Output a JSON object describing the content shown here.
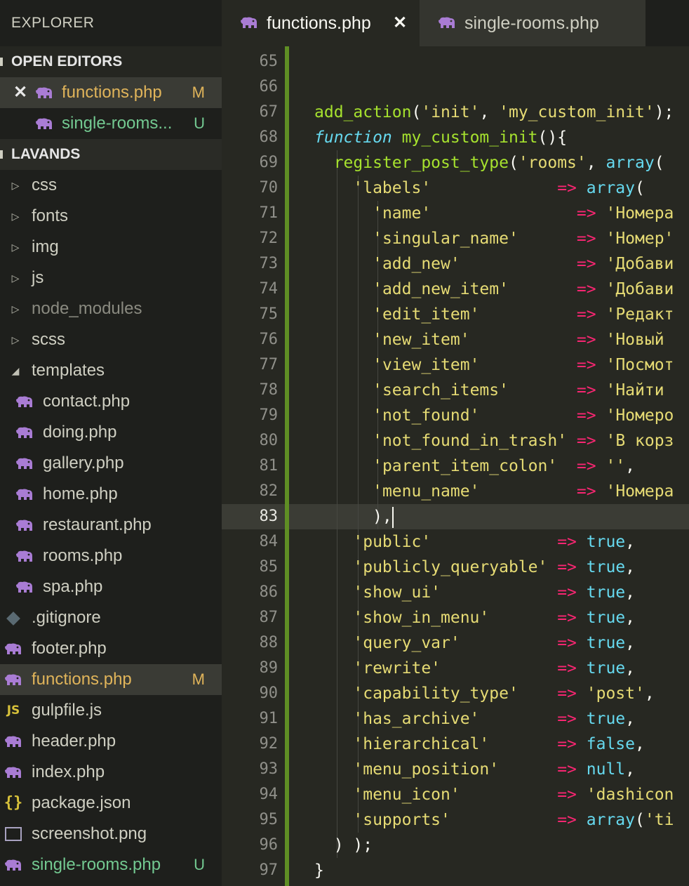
{
  "sidebar": {
    "title": "EXPLORER",
    "open_editors_label": "OPEN EDITORS",
    "open_editors": [
      {
        "label": "functions.php",
        "badge": "M",
        "active": true
      },
      {
        "label": "single-rooms...",
        "badge": "U",
        "active": false
      }
    ],
    "project_label": "LAVANDS",
    "folders": [
      {
        "label": "css"
      },
      {
        "label": "fonts"
      },
      {
        "label": "img"
      },
      {
        "label": "js"
      },
      {
        "label": "node_modules"
      },
      {
        "label": "scss"
      },
      {
        "label": "templates"
      }
    ],
    "template_files": [
      {
        "label": "contact.php"
      },
      {
        "label": "doing.php"
      },
      {
        "label": "gallery.php"
      },
      {
        "label": "home.php"
      },
      {
        "label": "restaurant.php"
      },
      {
        "label": "rooms.php"
      },
      {
        "label": "spa.php"
      }
    ],
    "root_files": [
      {
        "label": ".gitignore",
        "icon": "git-icon",
        "badge": ""
      },
      {
        "label": "footer.php",
        "icon": "php-icon",
        "badge": ""
      },
      {
        "label": "functions.php",
        "icon": "php-icon",
        "badge": "M"
      },
      {
        "label": "gulpfile.js",
        "icon": "js-icon",
        "badge": ""
      },
      {
        "label": "header.php",
        "icon": "php-icon",
        "badge": ""
      },
      {
        "label": "index.php",
        "icon": "php-icon",
        "badge": ""
      },
      {
        "label": "package.json",
        "icon": "json-icon",
        "badge": ""
      },
      {
        "label": "screenshot.png",
        "icon": "image-icon",
        "badge": ""
      },
      {
        "label": "single-rooms.php",
        "icon": "php-icon",
        "badge": "U"
      }
    ],
    "icons": {
      "js": "JS",
      "json": "{}"
    }
  },
  "tabs": [
    {
      "label": "functions.php",
      "active": true,
      "close": "✕"
    },
    {
      "label": "single-rooms.php",
      "active": false
    }
  ],
  "editor": {
    "current_line": 83,
    "lines": [
      {
        "n": "65",
        "tokens": []
      },
      {
        "n": "66",
        "tokens": []
      },
      {
        "n": "67",
        "tokens": [
          [
            "fn",
            "add_action"
          ],
          [
            "p",
            "("
          ],
          [
            "str",
            "'init'"
          ],
          [
            "p",
            ", "
          ],
          [
            "str",
            "'my_custom_init'"
          ],
          [
            "p",
            ");"
          ]
        ]
      },
      {
        "n": "68",
        "tokens": [
          [
            "kw",
            "function"
          ],
          [
            "p",
            " "
          ],
          [
            "fn",
            "my_custom_init"
          ],
          [
            "p",
            "(){"
          ]
        ]
      },
      {
        "n": "69",
        "tokens": [
          [
            "p",
            "  "
          ],
          [
            "fn",
            "register_post_type"
          ],
          [
            "p",
            "("
          ],
          [
            "str",
            "'rooms'"
          ],
          [
            "p",
            ", "
          ],
          [
            "kwn",
            "array"
          ],
          [
            "p",
            "("
          ]
        ]
      },
      {
        "n": "70",
        "tokens": [
          [
            "p",
            "    "
          ],
          [
            "str",
            "'labels'"
          ],
          [
            "p",
            "             "
          ],
          [
            "op",
            "=>"
          ],
          [
            "p",
            " "
          ],
          [
            "kwn",
            "array"
          ],
          [
            "p",
            "("
          ]
        ]
      },
      {
        "n": "71",
        "tokens": [
          [
            "p",
            "      "
          ],
          [
            "str",
            "'name'"
          ],
          [
            "p",
            "               "
          ],
          [
            "op",
            "=>"
          ],
          [
            "p",
            " "
          ],
          [
            "str",
            "'Номера"
          ]
        ]
      },
      {
        "n": "72",
        "tokens": [
          [
            "p",
            "      "
          ],
          [
            "str",
            "'singular_name'"
          ],
          [
            "p",
            "      "
          ],
          [
            "op",
            "=>"
          ],
          [
            "p",
            " "
          ],
          [
            "str",
            "'Номер'"
          ]
        ]
      },
      {
        "n": "73",
        "tokens": [
          [
            "p",
            "      "
          ],
          [
            "str",
            "'add_new'"
          ],
          [
            "p",
            "            "
          ],
          [
            "op",
            "=>"
          ],
          [
            "p",
            " "
          ],
          [
            "str",
            "'Добави"
          ]
        ]
      },
      {
        "n": "74",
        "tokens": [
          [
            "p",
            "      "
          ],
          [
            "str",
            "'add_new_item'"
          ],
          [
            "p",
            "       "
          ],
          [
            "op",
            "=>"
          ],
          [
            "p",
            " "
          ],
          [
            "str",
            "'Добави"
          ]
        ]
      },
      {
        "n": "75",
        "tokens": [
          [
            "p",
            "      "
          ],
          [
            "str",
            "'edit_item'"
          ],
          [
            "p",
            "          "
          ],
          [
            "op",
            "=>"
          ],
          [
            "p",
            " "
          ],
          [
            "str",
            "'Редакт"
          ]
        ]
      },
      {
        "n": "76",
        "tokens": [
          [
            "p",
            "      "
          ],
          [
            "str",
            "'new_item'"
          ],
          [
            "p",
            "           "
          ],
          [
            "op",
            "=>"
          ],
          [
            "p",
            " "
          ],
          [
            "str",
            "'Новый "
          ]
        ]
      },
      {
        "n": "77",
        "tokens": [
          [
            "p",
            "      "
          ],
          [
            "str",
            "'view_item'"
          ],
          [
            "p",
            "          "
          ],
          [
            "op",
            "=>"
          ],
          [
            "p",
            " "
          ],
          [
            "str",
            "'Посмот"
          ]
        ]
      },
      {
        "n": "78",
        "tokens": [
          [
            "p",
            "      "
          ],
          [
            "str",
            "'search_items'"
          ],
          [
            "p",
            "       "
          ],
          [
            "op",
            "=>"
          ],
          [
            "p",
            " "
          ],
          [
            "str",
            "'Найти "
          ]
        ]
      },
      {
        "n": "79",
        "tokens": [
          [
            "p",
            "      "
          ],
          [
            "str",
            "'not_found'"
          ],
          [
            "p",
            "          "
          ],
          [
            "op",
            "=>"
          ],
          [
            "p",
            " "
          ],
          [
            "str",
            "'Номеро"
          ]
        ]
      },
      {
        "n": "80",
        "tokens": [
          [
            "p",
            "      "
          ],
          [
            "str",
            "'not_found_in_trash'"
          ],
          [
            "p",
            " "
          ],
          [
            "op",
            "=>"
          ],
          [
            "p",
            " "
          ],
          [
            "str",
            "'В корз"
          ]
        ]
      },
      {
        "n": "81",
        "tokens": [
          [
            "p",
            "      "
          ],
          [
            "str",
            "'parent_item_colon'"
          ],
          [
            "p",
            "  "
          ],
          [
            "op",
            "=>"
          ],
          [
            "p",
            " "
          ],
          [
            "str",
            "''"
          ],
          [
            "p",
            ","
          ]
        ]
      },
      {
        "n": "82",
        "tokens": [
          [
            "p",
            "      "
          ],
          [
            "str",
            "'menu_name'"
          ],
          [
            "p",
            "          "
          ],
          [
            "op",
            "=>"
          ],
          [
            "p",
            " "
          ],
          [
            "str",
            "'Номера"
          ]
        ]
      },
      {
        "n": "83",
        "tokens": [
          [
            "p",
            "      ),"
          ]
        ],
        "cursor": true
      },
      {
        "n": "84",
        "tokens": [
          [
            "p",
            "    "
          ],
          [
            "str",
            "'public'"
          ],
          [
            "p",
            "             "
          ],
          [
            "op",
            "=>"
          ],
          [
            "p",
            " "
          ],
          [
            "kwn",
            "true"
          ],
          [
            "p",
            ","
          ]
        ]
      },
      {
        "n": "85",
        "tokens": [
          [
            "p",
            "    "
          ],
          [
            "str",
            "'publicly_queryable'"
          ],
          [
            "p",
            " "
          ],
          [
            "op",
            "=>"
          ],
          [
            "p",
            " "
          ],
          [
            "kwn",
            "true"
          ],
          [
            "p",
            ","
          ]
        ]
      },
      {
        "n": "86",
        "tokens": [
          [
            "p",
            "    "
          ],
          [
            "str",
            "'show_ui'"
          ],
          [
            "p",
            "            "
          ],
          [
            "op",
            "=>"
          ],
          [
            "p",
            " "
          ],
          [
            "kwn",
            "true"
          ],
          [
            "p",
            ","
          ]
        ]
      },
      {
        "n": "87",
        "tokens": [
          [
            "p",
            "    "
          ],
          [
            "str",
            "'show_in_menu'"
          ],
          [
            "p",
            "       "
          ],
          [
            "op",
            "=>"
          ],
          [
            "p",
            " "
          ],
          [
            "kwn",
            "true"
          ],
          [
            "p",
            ","
          ]
        ]
      },
      {
        "n": "88",
        "tokens": [
          [
            "p",
            "    "
          ],
          [
            "str",
            "'query_var'"
          ],
          [
            "p",
            "          "
          ],
          [
            "op",
            "=>"
          ],
          [
            "p",
            " "
          ],
          [
            "kwn",
            "true"
          ],
          [
            "p",
            ","
          ]
        ]
      },
      {
        "n": "89",
        "tokens": [
          [
            "p",
            "    "
          ],
          [
            "str",
            "'rewrite'"
          ],
          [
            "p",
            "            "
          ],
          [
            "op",
            "=>"
          ],
          [
            "p",
            " "
          ],
          [
            "kwn",
            "true"
          ],
          [
            "p",
            ","
          ]
        ]
      },
      {
        "n": "90",
        "tokens": [
          [
            "p",
            "    "
          ],
          [
            "str",
            "'capability_type'"
          ],
          [
            "p",
            "    "
          ],
          [
            "op",
            "=>"
          ],
          [
            "p",
            " "
          ],
          [
            "str",
            "'post'"
          ],
          [
            "p",
            ","
          ]
        ]
      },
      {
        "n": "91",
        "tokens": [
          [
            "p",
            "    "
          ],
          [
            "str",
            "'has_archive'"
          ],
          [
            "p",
            "        "
          ],
          [
            "op",
            "=>"
          ],
          [
            "p",
            " "
          ],
          [
            "kwn",
            "true"
          ],
          [
            "p",
            ","
          ]
        ]
      },
      {
        "n": "92",
        "tokens": [
          [
            "p",
            "    "
          ],
          [
            "str",
            "'hierarchical'"
          ],
          [
            "p",
            "       "
          ],
          [
            "op",
            "=>"
          ],
          [
            "p",
            " "
          ],
          [
            "kwn",
            "false"
          ],
          [
            "p",
            ","
          ]
        ]
      },
      {
        "n": "93",
        "tokens": [
          [
            "p",
            "    "
          ],
          [
            "str",
            "'menu_position'"
          ],
          [
            "p",
            "      "
          ],
          [
            "op",
            "=>"
          ],
          [
            "p",
            " "
          ],
          [
            "kwn",
            "null"
          ],
          [
            "p",
            ","
          ]
        ]
      },
      {
        "n": "94",
        "tokens": [
          [
            "p",
            "    "
          ],
          [
            "str",
            "'menu_icon'"
          ],
          [
            "p",
            "          "
          ],
          [
            "op",
            "=>"
          ],
          [
            "p",
            " "
          ],
          [
            "str",
            "'dashicon"
          ]
        ]
      },
      {
        "n": "95",
        "tokens": [
          [
            "p",
            "    "
          ],
          [
            "str",
            "'supports'"
          ],
          [
            "p",
            "           "
          ],
          [
            "op",
            "=>"
          ],
          [
            "p",
            " "
          ],
          [
            "kwn",
            "array"
          ],
          [
            "p",
            "("
          ],
          [
            "str",
            "'ti"
          ]
        ]
      },
      {
        "n": "96",
        "tokens": [
          [
            "p",
            "  ) );"
          ]
        ]
      },
      {
        "n": "97",
        "tokens": [
          [
            "p",
            "}"
          ]
        ]
      }
    ]
  }
}
